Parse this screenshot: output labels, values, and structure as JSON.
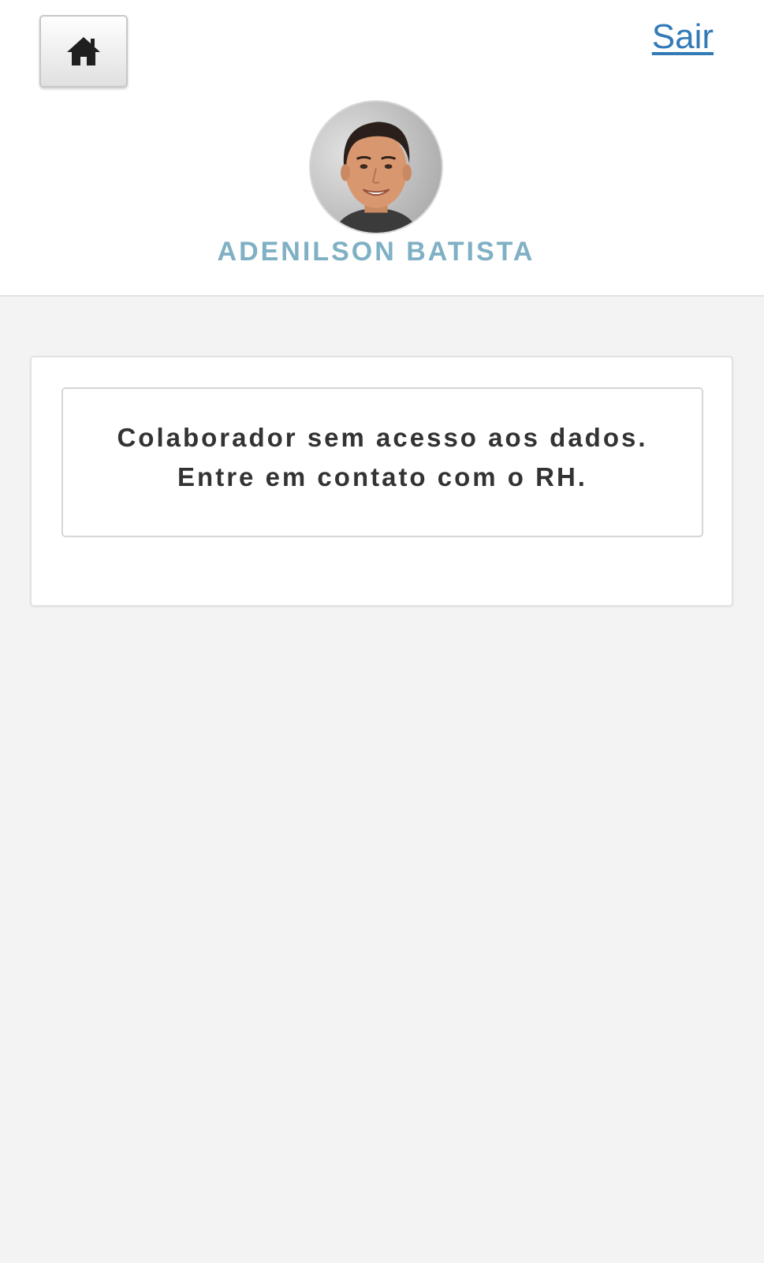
{
  "header": {
    "home_icon": "home-icon",
    "logout_label": "Sair",
    "user_name": "ADENILSON BATISTA",
    "avatar": "user-avatar-photo"
  },
  "message": {
    "line1": "Colaborador sem acesso aos dados.",
    "line2": "Entre em contato com o RH."
  },
  "colors": {
    "link": "#337ab7",
    "user_name": "#7fb0c4",
    "background": "#f3f3f3",
    "text": "#333333"
  }
}
